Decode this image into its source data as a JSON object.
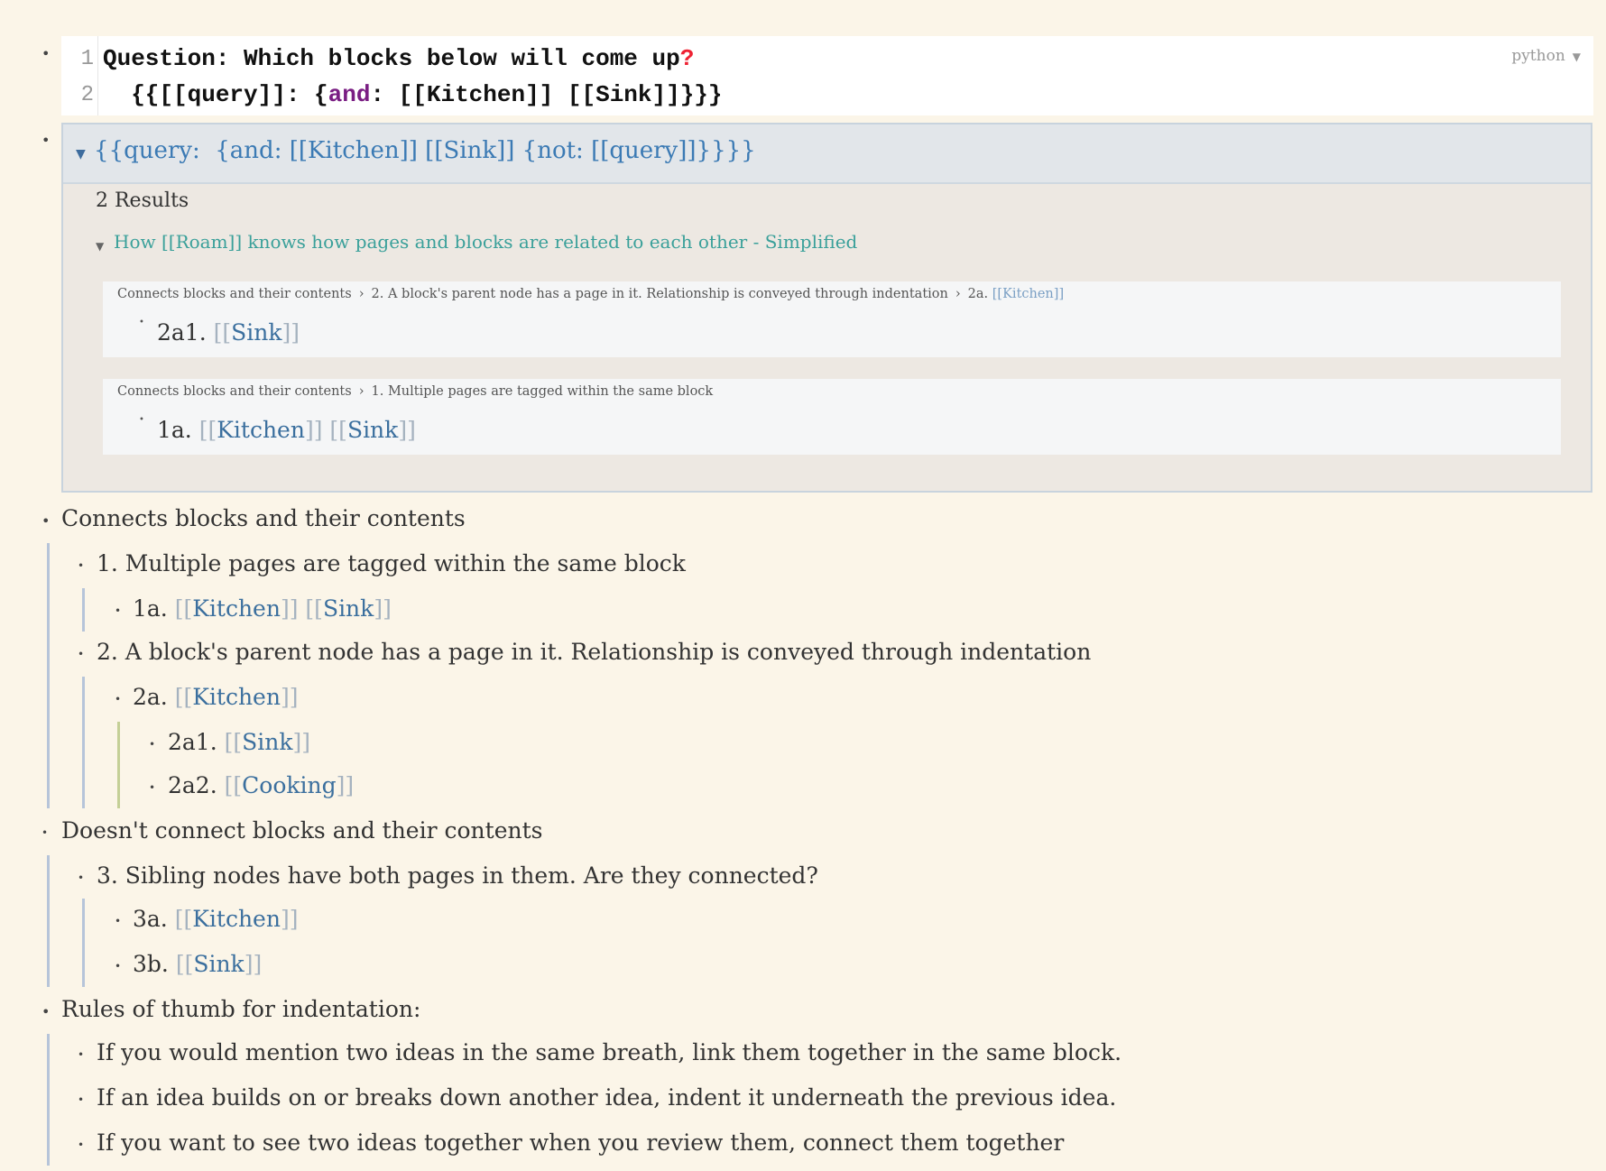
{
  "code": {
    "line_numbers": [
      "1",
      "2"
    ],
    "line1": "Question: Which blocks below will come up",
    "line1_mark": "?",
    "line2_pre": "  {{[[query]]: {",
    "line2_kw": "and",
    "line2_post": ": [[Kitchen]] [[Sink]]}}}",
    "language": "python"
  },
  "query": {
    "text": "{{query:  {and: [[Kitchen]] [[Sink]] {not: [[query]]}}}}",
    "results_count": "2 Results",
    "page_title": "How [[Roam]] knows how pages and blocks are related to each other - Simplified",
    "results": [
      {
        "crumbs": [
          "Connects blocks and their contents",
          "2. A block's parent node has a page in it. Relationship is conveyed through indentation",
          "2a."
        ],
        "crumb_link": "Kitchen",
        "label": "2a1.",
        "pages": [
          "Sink"
        ]
      },
      {
        "crumbs": [
          "Connects blocks and their contents",
          "1. Multiple pages are tagged within the same block"
        ],
        "label": "1a.",
        "pages": [
          "Kitchen",
          "Sink"
        ]
      }
    ]
  },
  "outline": {
    "b1": "Connects blocks and their contents",
    "b1_1": "1. Multiple pages are tagged within the same block",
    "b1_1a_label": "1a.",
    "b1_1a_pages": [
      "Kitchen",
      "Sink"
    ],
    "b1_2": "2. A block's parent node has a page in it. Relationship is conveyed through indentation",
    "b1_2a_label": "2a.",
    "b1_2a_page": "Kitchen",
    "b1_2a1_label": "2a1.",
    "b1_2a1_page": "Sink",
    "b1_2a2_label": "2a2.",
    "b1_2a2_page": "Cooking",
    "b2": "Doesn't connect blocks and their contents",
    "b2_3": "3. Sibling nodes have both pages in them. Are they connected?",
    "b2_3a_label": "3a.",
    "b2_3a_page": "Kitchen",
    "b2_3b_label": "3b.",
    "b2_3b_page": "Sink",
    "b3": "Rules of thumb for indentation:",
    "b3_r1": "If you would mention two ideas in the same breath, link them together in the same block.",
    "b3_r2": "If an idea builds on or breaks down another idea, indent it underneath the previous idea.",
    "b3_r3": "If you want to see two ideas together when you review them, connect them together"
  }
}
